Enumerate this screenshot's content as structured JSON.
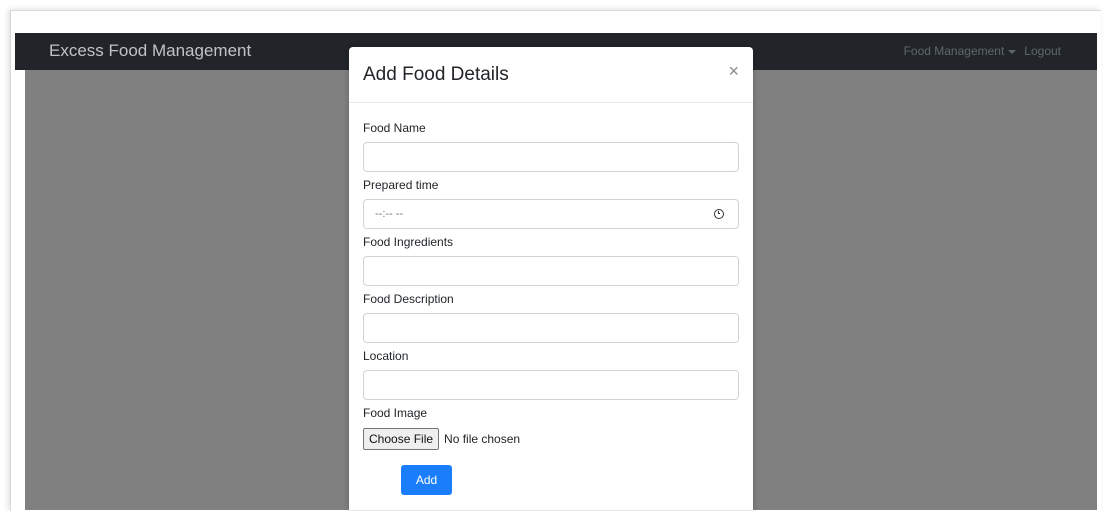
{
  "navbar": {
    "brand": "Excess Food Management",
    "food_management_label": "Food Management",
    "logout_label": "Logout"
  },
  "modal": {
    "title": "Add Food Details",
    "close_glyph": "×",
    "fields": {
      "food_name": {
        "label": "Food Name",
        "value": ""
      },
      "prepared_time": {
        "label": "Prepared time",
        "value": "--:-- --"
      },
      "food_ingredients": {
        "label": "Food Ingredients",
        "value": ""
      },
      "food_description": {
        "label": "Food Description",
        "value": ""
      },
      "location": {
        "label": "Location",
        "value": ""
      },
      "food_image": {
        "label": "Food Image",
        "button_label": "Choose File",
        "status": "No file chosen"
      }
    },
    "submit_label": "Add"
  },
  "colors": {
    "navbar_bg": "#212529",
    "backdrop": "#808080",
    "primary": "#1a7df9"
  }
}
